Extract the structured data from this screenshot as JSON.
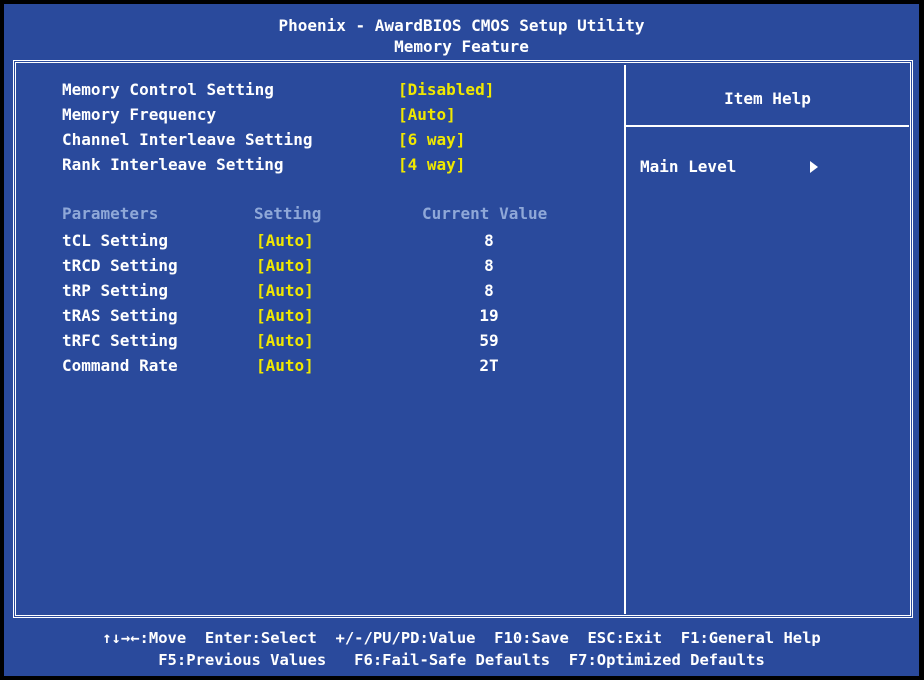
{
  "header": {
    "title": "Phoenix - AwardBIOS CMOS Setup Utility",
    "subtitle": "Memory Feature"
  },
  "settings": [
    {
      "label": "Memory Control Setting",
      "value": "[Disabled]"
    },
    {
      "label": "Memory Frequency",
      "value": "[Auto]"
    },
    {
      "label": "Channel Interleave Setting",
      "value": "[6 way]"
    },
    {
      "label": "Rank Interleave Setting",
      "value": "[4 way]"
    }
  ],
  "params_header": {
    "parameters": "Parameters",
    "setting": "Setting",
    "current": "Current Value"
  },
  "params": [
    {
      "label": "tCL Setting",
      "setting": "[Auto]",
      "current": "8"
    },
    {
      "label": "tRCD Setting",
      "setting": "[Auto]",
      "current": "8"
    },
    {
      "label": "tRP Setting",
      "setting": "[Auto]",
      "current": "8"
    },
    {
      "label": "tRAS Setting",
      "setting": "[Auto]",
      "current": "19"
    },
    {
      "label": "tRFC Setting",
      "setting": "[Auto]",
      "current": "59"
    },
    {
      "label": "Command Rate",
      "setting": "[Auto]",
      "current": "2T"
    }
  ],
  "help": {
    "title": "Item Help",
    "main_level": "Main Level"
  },
  "footer": {
    "line1": "↑↓→←:Move  Enter:Select  +/-/PU/PD:Value  F10:Save  ESC:Exit  F1:General Help",
    "line2": "F5:Previous Values   F6:Fail-Safe Defaults  F7:Optimized Defaults"
  },
  "colors": {
    "background": "#2a4a9c",
    "value": "#f0e800",
    "header_dim": "#8fa8d8",
    "text": "#ffffff"
  },
  "icons": {
    "main_level_arrow": "triangle-right-icon"
  }
}
